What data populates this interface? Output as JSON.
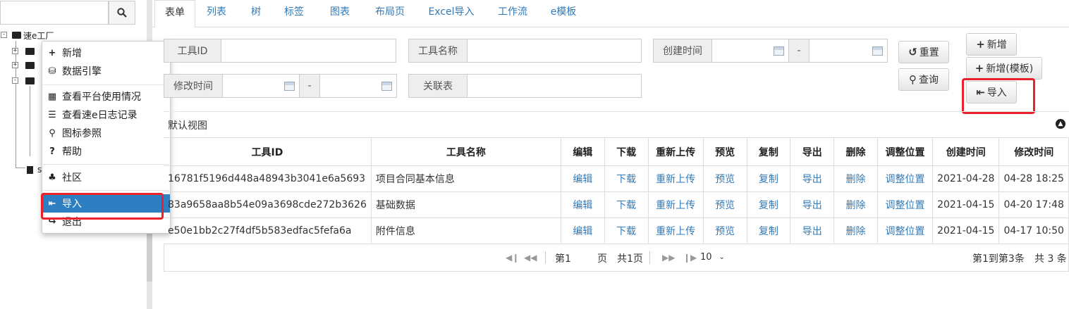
{
  "search": {
    "placeholder": "",
    "icon": "search-icon"
  },
  "tree": {
    "root_label": "速e工厂",
    "last_label": "s"
  },
  "context_menu": {
    "items": [
      {
        "label": "新增",
        "icon": "plus-icon"
      },
      {
        "label": "数据引擎",
        "icon": "database-icon"
      },
      {
        "label": "查看平台使用情况",
        "icon": "calculator-icon"
      },
      {
        "label": "查看速e日志记录",
        "icon": "list-icon"
      },
      {
        "label": "图标参照",
        "icon": "search-icon"
      },
      {
        "label": "帮助",
        "icon": "question-icon"
      },
      {
        "label": "社区",
        "icon": "community-icon"
      },
      {
        "label": "导入",
        "icon": "import-icon"
      },
      {
        "label": "退出",
        "icon": "logout-icon"
      }
    ]
  },
  "tabs": [
    {
      "label": "表单"
    },
    {
      "label": "列表"
    },
    {
      "label": "树"
    },
    {
      "label": "标签"
    },
    {
      "label": "图表"
    },
    {
      "label": "布局页"
    },
    {
      "label": "Excel导入"
    },
    {
      "label": "工作流"
    },
    {
      "label": "e模板"
    }
  ],
  "form": {
    "tool_id_label": "工具ID",
    "tool_name_label": "工具名称",
    "created_label": "创建时间",
    "modified_label": "修改时间",
    "related_label": "关联表",
    "range_sep": "-"
  },
  "buttons": {
    "reset": "重置",
    "query": "查询",
    "add": "新增",
    "add_template": "新增(模板)",
    "import": "导入"
  },
  "panel": {
    "title": "默认视图"
  },
  "table": {
    "headers": [
      "工具ID",
      "工具名称",
      "编辑",
      "下载",
      "重新上传",
      "预览",
      "复制",
      "导出",
      "删除",
      "调整位置",
      "创建时间",
      "修改时间"
    ],
    "rows": [
      [
        "16781f5196d448a48943b3041e6a5693",
        "项目合同基本信息",
        "编辑",
        "下载",
        "重新上传",
        "预览",
        "复制",
        "导出",
        "删除",
        "调整位置",
        "2021-04-28",
        "04-28 18:25"
      ],
      [
        "83a9658aa8b54e09a3698cde272b3626",
        "基础数据",
        "编辑",
        "下载",
        "重新上传",
        "预览",
        "复制",
        "导出",
        "删除",
        "调整位置",
        "2021-04-15",
        "04-20 17:48"
      ],
      [
        "e50e1bb2c27f4df5b583edfac5fefa6a",
        "附件信息",
        "编辑",
        "下载",
        "重新上传",
        "预览",
        "复制",
        "导出",
        "删除",
        "调整位置",
        "2021-04-15",
        "04-17 10:50"
      ]
    ]
  },
  "pager": {
    "page_prefix": "第1",
    "page_suffix": "页",
    "total_pages": "共1页",
    "page_size": "10",
    "summary": "第1到第3条",
    "total": "共 3 条"
  },
  "colors": {
    "accent": "#337ab7",
    "highlight": "#2d7fc1",
    "annotation": "#e8212a"
  }
}
